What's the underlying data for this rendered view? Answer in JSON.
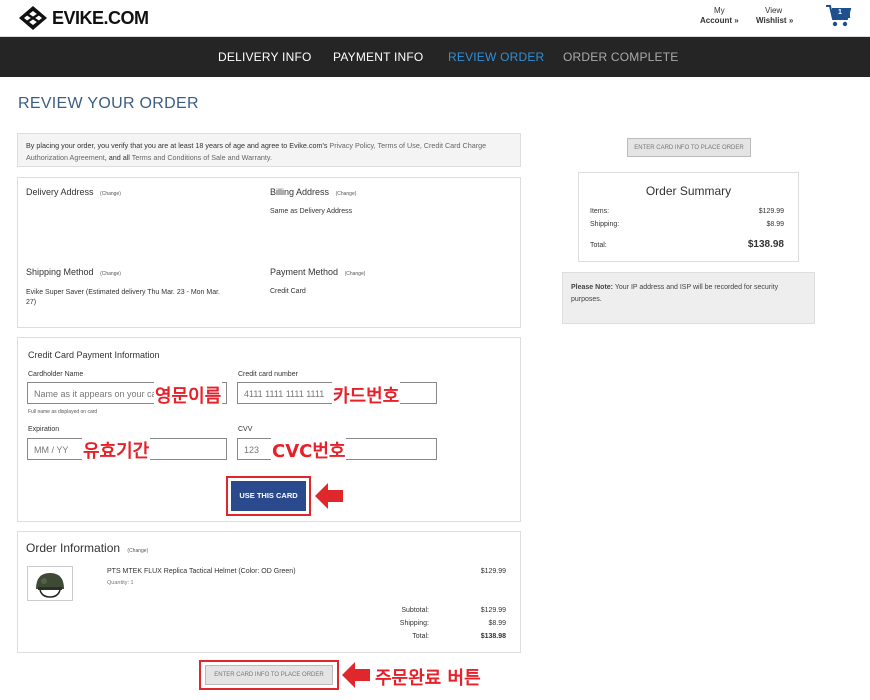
{
  "header": {
    "logo_text": "EVIKE.COM",
    "my_account_top": "My",
    "my_account_bottom": "Account »",
    "wishlist_top": "View",
    "wishlist_bottom": "Wishlist »",
    "cart_count": "1"
  },
  "nav": {
    "items": [
      "DELIVERY INFO",
      "PAYMENT INFO",
      "REVIEW ORDER",
      "ORDER COMPLETE"
    ],
    "active_index": 2,
    "active_color": "#2f8fd8"
  },
  "page_title": "REVIEW YOUR ORDER",
  "agreement": {
    "line1_a": "By placing your order, you verify that you are at least 18 years of age and agree to Evike.com's ",
    "line1_b": "Privacy Policy, Terms of Use, Credit Card Charge",
    "line2_a": "Authorization Agreement",
    "line2_b": ", and all ",
    "line2_c": "Terms and Conditions of Sale and Warranty."
  },
  "address": {
    "delivery_title": "Delivery Address",
    "billing_title": "Billing Address",
    "billing_value": "Same as Delivery Address",
    "shipping_title": "Shipping Method",
    "shipping_value_1": "Evike Super Saver (Estimated delivery Thu Mar. 23 - Mon Mar.",
    "shipping_value_2": "27)",
    "payment_title": "Payment Method",
    "payment_value": "Credit Card",
    "change": "(Change)"
  },
  "card_form": {
    "title": "Credit Card Payment Information",
    "name_label": "Cardholder Name",
    "name_placeholder": "Name as it appears on your card",
    "name_hint": "Full name as displayed on card",
    "number_label": "Credit card number",
    "number_placeholder": "4111 1111 1111 1111",
    "exp_label": "Expiration",
    "exp_placeholder": "MM / YY",
    "cvv_label": "CVV",
    "cvv_placeholder": "123",
    "use_card_button": "USE THIS CARD"
  },
  "annotations": {
    "name": "영문이름",
    "number": "카드번호",
    "exp": "유효기간",
    "cvv": "CVC번호",
    "place_order": "주문완료 버튼",
    "color": "#e0272b"
  },
  "order_info": {
    "title": "Order Information",
    "change": "(Change)",
    "item_name": "PTS MTEK FLUX Replica Tactical Helmet (Color: OD Green)",
    "item_qty": "Quantity: 1",
    "item_price": "$129.99",
    "subtotal_label": "Subtotal:",
    "subtotal": "$129.99",
    "shipping_label": "Shipping:",
    "shipping": "$8.99",
    "total_label": "Total:",
    "total": "$138.98"
  },
  "place_order_button": "ENTER CARD INFO TO PLACE ORDER",
  "summary": {
    "title": "Order Summary",
    "items_label": "Items:",
    "items": "$129.99",
    "shipping_label": "Shipping:",
    "shipping": "$8.99",
    "total_label": "Total:",
    "total": "$138.98"
  },
  "note": {
    "bold": "Please Note:",
    "text_1": " Your IP address and ISP will be recorded for security",
    "text_2": "purposes."
  }
}
